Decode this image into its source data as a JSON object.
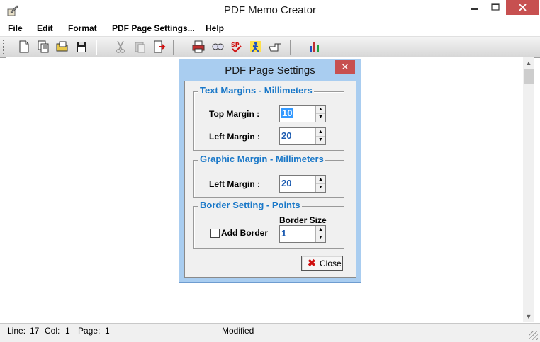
{
  "window": {
    "title": "PDF Memo Creator",
    "min_glyph": "—",
    "max_glyph": "☐",
    "close_glyph": "✕",
    "app_icon": "quill-pen-icon"
  },
  "menu": {
    "items": [
      "File",
      "Edit",
      "Format",
      "PDF Page Settings...",
      "Help"
    ]
  },
  "toolbar": {
    "buttons": [
      "new-document",
      "copy-documents",
      "open-folder",
      "save-disk",
      "cut-disabled",
      "paste-disabled",
      "exit-door",
      "print",
      "print-preview",
      "spell-check",
      "run-figure",
      "pointer",
      "bar-chart"
    ]
  },
  "dialog": {
    "title": "PDF Page Settings",
    "close_glyph": "✕",
    "text_margins": {
      "title": "Text Margins - Millimeters",
      "top_label": "Top Margin :",
      "top_value": "10",
      "left_label": "Left Margin :",
      "left_value": "20"
    },
    "graphic_margin": {
      "title": "Graphic Margin - Millimeters",
      "left_label": "Left Margin :",
      "left_value": "20"
    },
    "border": {
      "title": "Border Setting - Points",
      "checkbox_label": "Add Border",
      "checked": false,
      "size_label": "Border Size",
      "size_value": "1"
    },
    "close_button_label": "Close"
  },
  "status": {
    "line_label": "Line:",
    "line_value": "17",
    "col_label": "Col:",
    "col_value": "1",
    "page_label": "Page:",
    "page_value": "1",
    "state": "Modified"
  },
  "colors": {
    "group_title": "#1a78c8",
    "dialog_frame": "#a9cdf0",
    "close_red": "#c75050"
  }
}
